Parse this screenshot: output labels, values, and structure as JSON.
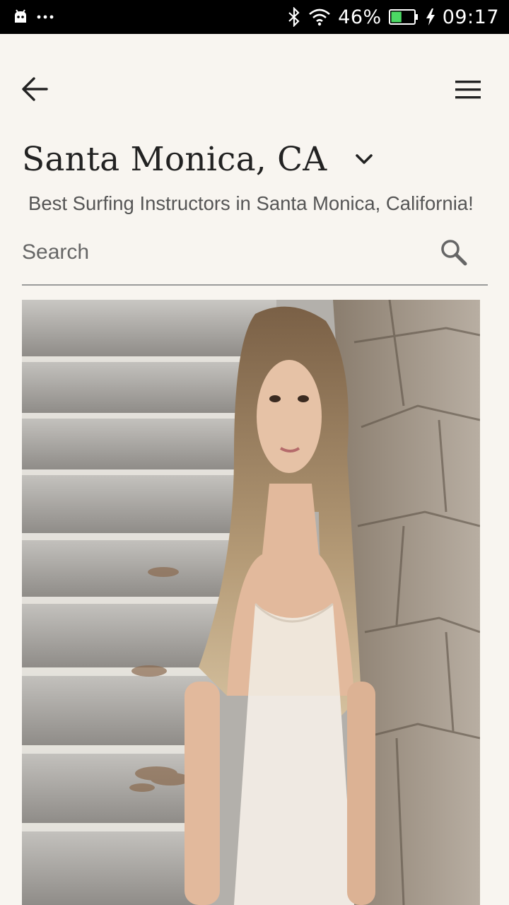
{
  "status_bar": {
    "icons": [
      "android-icon",
      "more-dots-icon",
      "bluetooth-icon",
      "wifi-icon",
      "battery-icon",
      "charging-icon"
    ],
    "battery_percent": "46%",
    "battery_level": 0.46,
    "time": "09:17"
  },
  "header": {
    "back_icon": "arrow-left-icon",
    "menu_icon": "hamburger-menu-icon"
  },
  "location": {
    "title": "Santa Monica, CA",
    "dropdown_icon": "chevron-down-icon"
  },
  "tagline": "Best Surfing Instructors in Santa Monica, California!",
  "search": {
    "placeholder": "Search",
    "value": "",
    "icon": "search-icon"
  },
  "featured_photo": {
    "subject": "woman with long hair leaning against stone wall beside stone steps"
  },
  "colors": {
    "background": "#f8f5f0",
    "status_bar": "#000000",
    "battery_fill": "#4cd964",
    "text_primary": "#222222",
    "text_secondary": "#555555"
  }
}
